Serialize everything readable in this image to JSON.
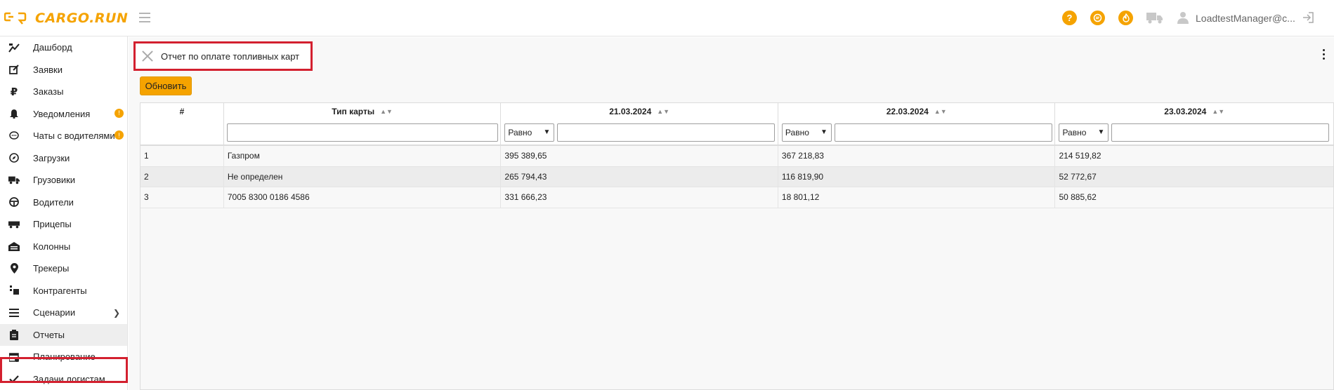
{
  "brand": {
    "name": "CARGO.RUN",
    "accent": "#f5a300"
  },
  "header": {
    "icons": [
      "help-icon",
      "chat-icon",
      "fire-icon",
      "truck-icon",
      "user-icon",
      "logout-icon"
    ],
    "user_name": "LoadtestManager@c..."
  },
  "sidebar": {
    "items": [
      {
        "label": "Дашборд",
        "icon": "dashboard-icon"
      },
      {
        "label": "Заявки",
        "icon": "edit-icon"
      },
      {
        "label": "Заказы",
        "icon": "ruble-icon"
      },
      {
        "label": "Уведомления",
        "icon": "bell-icon",
        "badge": "!"
      },
      {
        "label": "Чаты с водителями",
        "icon": "chat-icon",
        "badge": "!"
      },
      {
        "label": "Загрузки",
        "icon": "compass-icon"
      },
      {
        "label": "Грузовики",
        "icon": "truck-icon"
      },
      {
        "label": "Водители",
        "icon": "steering-wheel-icon"
      },
      {
        "label": "Прицепы",
        "icon": "trailer-icon"
      },
      {
        "label": "Колонны",
        "icon": "garage-icon"
      },
      {
        "label": "Трекеры",
        "icon": "map-pin-icon"
      },
      {
        "label": "Контрагенты",
        "icon": "contacts-icon"
      },
      {
        "label": "Сценарии",
        "icon": "list-icon",
        "chevron": true
      },
      {
        "label": "Отчеты",
        "icon": "clipboard-icon",
        "active": true
      },
      {
        "label": "Планирование",
        "icon": "calendar-icon"
      },
      {
        "label": "Задачи логистам",
        "icon": "check-icon"
      }
    ]
  },
  "report": {
    "title": "Отчет по оплате топливных карт",
    "refresh_label": "Обновить"
  },
  "table": {
    "columns": [
      "#",
      "Тип карты",
      "21.03.2024",
      "22.03.2024",
      "23.03.2024"
    ],
    "filter_operator": "Равно",
    "rows": [
      [
        "1",
        "Газпром",
        "395 389,65",
        "367 218,83",
        "214 519,82"
      ],
      [
        "2",
        "Не определен",
        "265 794,43",
        "116 819,90",
        "52 772,67"
      ],
      [
        "3",
        "7005 8300 0186 4586",
        "331 666,23",
        "18 801,12",
        "50 885,62"
      ]
    ]
  }
}
